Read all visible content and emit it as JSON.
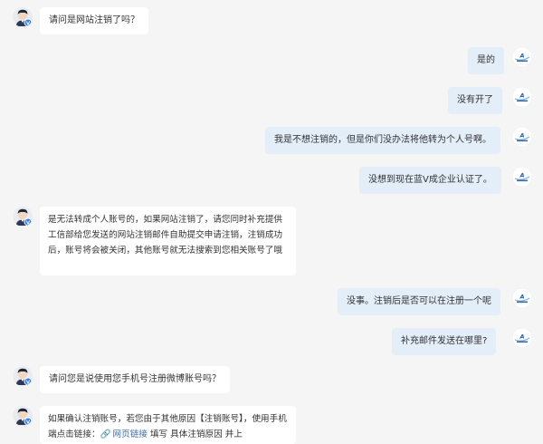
{
  "colors": {
    "background": "#f5f5f5",
    "bubble_left": "#ffffff",
    "bubble_right": "#e3eef9",
    "text": "#333333",
    "link": "#3a6ea5",
    "verified_badge": "#2d7cf6"
  },
  "messages": [
    {
      "side": "left",
      "text": "请问是网站注销了吗？"
    },
    {
      "side": "right",
      "text": "是的"
    },
    {
      "side": "right",
      "text": "没有开了"
    },
    {
      "side": "right",
      "text": "我是不想注销的，但是你们没办法将他转为个人号啊。"
    },
    {
      "side": "right",
      "text": "没想到现在蓝V成企业认证了。"
    },
    {
      "side": "left",
      "text": "是无法转成个人账号的，如果网站注销了，请您同时补充提供工信部给您发送的网站注销邮件自助提交申请注销，注销成功后，账号将会被关闭，其他账号就无法搜索到您相关账号了哦"
    },
    {
      "side": "right",
      "text": "没事。注销后是否可以在注册一个呢"
    },
    {
      "side": "right",
      "text": "补充邮件发送在哪里?"
    },
    {
      "side": "left",
      "text": "请问您是说使用您手机号注册微博账号吗？"
    },
    {
      "side": "left",
      "text_before": "如果确认注销账号，若您由于其他原因【注销账号】，使用手机端点击链接：",
      "link_icon": "link-icon",
      "link_text": "网页链接",
      "text_after": " 填写 具体注销原因 并上"
    }
  ]
}
